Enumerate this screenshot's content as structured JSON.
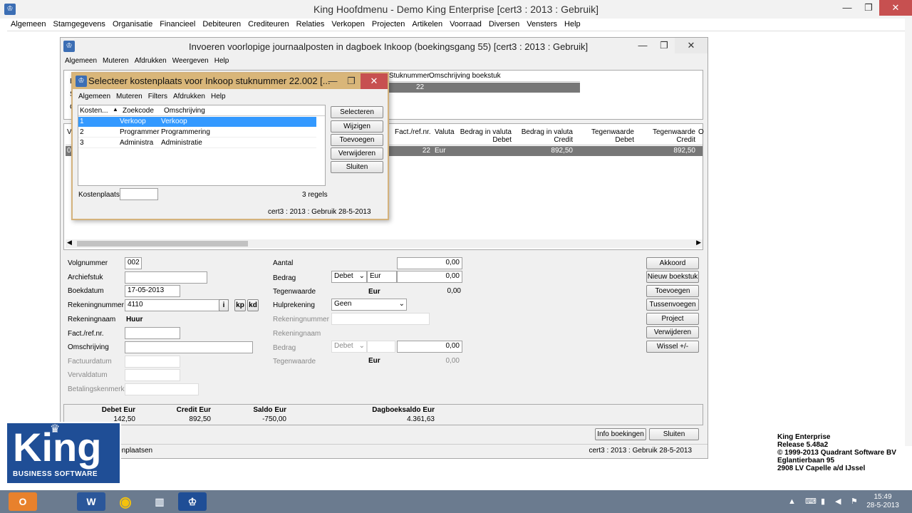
{
  "main_window": {
    "title": "King  Hoofdmenu - Demo King Enterprise [cert3 : 2013 : Gebruik]",
    "menu": [
      "Algemeen",
      "Stamgegevens",
      "Organisatie",
      "Financieel",
      "Debiteuren",
      "Crediteuren",
      "Relaties",
      "Verkopen",
      "Projecten",
      "Artikelen",
      "Voorraad",
      "Diversen",
      "Vensters",
      "Help"
    ]
  },
  "journal_window": {
    "title": "Invoeren voorlopige journaalposten in dagboek Inkoop (boekingsgang 55)  [cert3 : 2013 : Gebruik]",
    "menu": [
      "Algemeen",
      "Muteren",
      "Afdrukken",
      "Weergeven",
      "Help"
    ],
    "top_grid": {
      "headers": [
        "Stuknummer",
        "Omschrijving boekstuk"
      ],
      "row": [
        "22",
        ""
      ],
      "left_labels": [
        "B",
        "S",
        "O"
      ]
    },
    "lines_grid": {
      "headers": [
        "V",
        "Fact./ref.nr.",
        "Valuta",
        "Bedrag in valuta Debet",
        "Bedrag in valuta Credit",
        "Tegenwaarde Debet",
        "Tegenwaarde Credit",
        "O"
      ],
      "row": [
        "00",
        "22",
        "Eur",
        "",
        "892,50",
        "",
        "892,50",
        ""
      ]
    },
    "form": {
      "volgnummer_label": "Volgnummer",
      "volgnummer": "002",
      "archiefstuk_label": "Archiefstuk",
      "archiefstuk": "",
      "boekdatum_label": "Boekdatum",
      "boekdatum": "17-05-2013",
      "rekeningnummer_label": "Rekeningnummer",
      "rekeningnummer": "4110",
      "rekeningnaam_label": "Rekeningnaam",
      "rekeningnaam": "Huur",
      "fact_label": "Fact./ref.nr.",
      "fact": "",
      "omschrijving_label": "Omschrijving",
      "omschrijving": "",
      "factuurdatum_label": "Factuurdatum",
      "vervaldatum_label": "Vervaldatum",
      "betalingskenmerk_label": "Betalingskenmerk",
      "info_btn": "i",
      "kp_btn": "kp",
      "kd_btn": "kd",
      "aantal_label": "Aantal",
      "aantal": "0,00",
      "bedrag_label": "Bedrag",
      "bedrag_type": "Debet",
      "bedrag_valuta": "Eur",
      "bedrag": "0,00",
      "tegenwaarde_label": "Tegenwaarde",
      "tegenwaarde_valuta": "Eur",
      "tegenwaarde": "0,00",
      "hulprekening_label": "Hulprekening",
      "hulprekening": "Geen",
      "h_rekeningnummer_label": "Rekeningnummer",
      "h_rekeningnaam_label": "Rekeningnaam",
      "h_bedrag_label": "Bedrag",
      "h_bedrag_type": "Debet",
      "h_bedrag": "0,00",
      "h_tegenwaarde_label": "Tegenwaarde",
      "h_tegenwaarde_valuta": "Eur",
      "h_tegenwaarde": "0,00"
    },
    "side_buttons": [
      "Akkoord",
      "Nieuw boekstuk",
      "Toevoegen",
      "Tussenvoegen",
      "Project",
      "Verwijderen",
      "Wissel +/-"
    ],
    "totals": {
      "debet_label": "Debet Eur",
      "debet": "142,50",
      "credit_label": "Credit Eur",
      "credit": "892,50",
      "saldo_label": "Saldo Eur",
      "saldo": "-750,00",
      "dagboek_label": "Dagboeksaldo Eur",
      "dagboek": "4.361,63"
    },
    "bottom_buttons": [
      "Info boekingen",
      "Sluiten"
    ],
    "status_left": "Zoekvenster kostenplaatsen",
    "status_right": "cert3 : 2013 : Gebruik  28-5-2013"
  },
  "dialog": {
    "title": "Selecteer kostenplaats voor Inkoop stuknummer 22.002  [...",
    "menu": [
      "Algemeen",
      "Muteren",
      "Filters",
      "Afdrukken",
      "Help"
    ],
    "headers": [
      "Kosten...",
      "Zoekcode",
      "Omschrijving"
    ],
    "rows": [
      [
        "1",
        "Verkoop",
        "Verkoop"
      ],
      [
        "2",
        "Programmer",
        "Programmering"
      ],
      [
        "3",
        "Administra",
        "Administratie"
      ]
    ],
    "buttons": [
      "Selecteren",
      "Wijzigen",
      "Toevoegen",
      "Verwijderen",
      "Sluiten"
    ],
    "kostenplaats_label": "Kostenplaats",
    "regels": "3 regels",
    "status": "cert3 : 2013 : Gebruik  28-5-2013"
  },
  "release_info": [
    "King Enterprise",
    "Release 5.48a2",
    "© 1999-2013 Quadrant Software BV",
    "Eglantierbaan 95",
    "2908 LV Capelle a/d IJssel"
  ],
  "logo": {
    "name": "King",
    "tagline": "BUSINESS SOFTWARE"
  },
  "taskbar": {
    "time": "15:49",
    "date": "28-5-2013"
  },
  "colors": {
    "accent": "#3c6eb4",
    "dialog_title": "#d9b679",
    "selection": "#3399ff",
    "close": "#c75050"
  }
}
